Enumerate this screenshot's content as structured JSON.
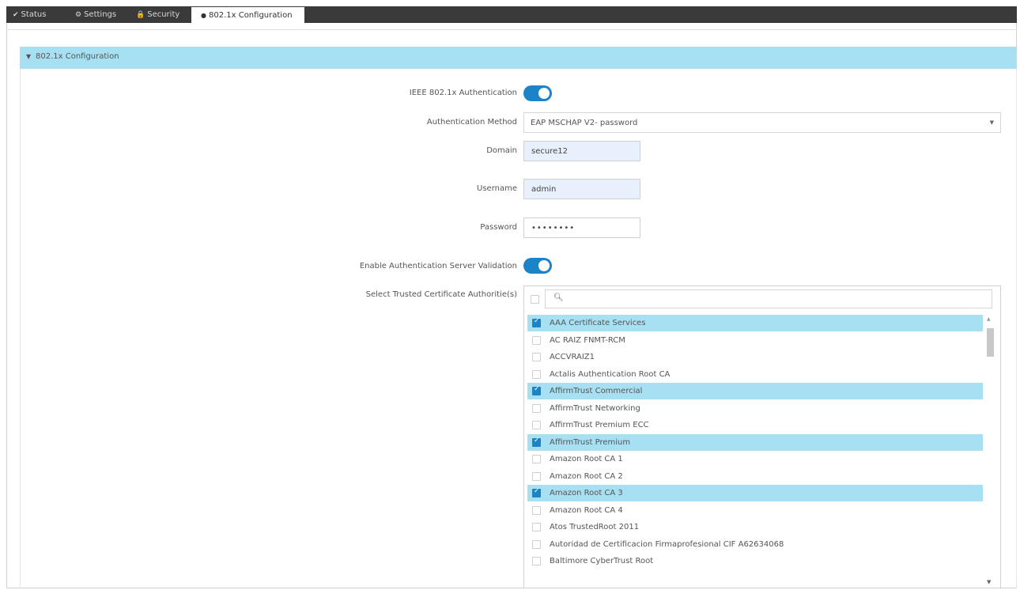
{
  "tabs": [
    {
      "icon": "✔",
      "label": "Status"
    },
    {
      "icon": "⚙",
      "label": "Settings"
    },
    {
      "icon": "🔒",
      "label": "Security"
    },
    {
      "icon": "●",
      "label": "802.1x Configuration"
    }
  ],
  "section": {
    "title": "802.1x Configuration"
  },
  "form": {
    "ieee_auth": {
      "label": "IEEE 802.1x Authentication",
      "enabled": true
    },
    "auth_method": {
      "label": "Authentication Method",
      "value": "EAP MSCHAP V2- password"
    },
    "domain": {
      "label": "Domain",
      "value": "secure12"
    },
    "username": {
      "label": "Username",
      "value": "admin"
    },
    "password": {
      "label": "Password",
      "value": "••••••••"
    },
    "server_validation": {
      "label": "Enable Authentication Server Validation",
      "enabled": true
    },
    "trusted_ca": {
      "label": "Select Trusted Certificate Authoritie(s)"
    }
  },
  "ca_list": [
    {
      "name": "AAA Certificate Services",
      "checked": true
    },
    {
      "name": "AC RAIZ FNMT-RCM",
      "checked": false
    },
    {
      "name": "ACCVRAIZ1",
      "checked": false
    },
    {
      "name": "Actalis Authentication Root CA",
      "checked": false
    },
    {
      "name": "AffirmTrust Commercial",
      "checked": true
    },
    {
      "name": "AffirmTrust Networking",
      "checked": false
    },
    {
      "name": "AffirmTrust Premium ECC",
      "checked": false
    },
    {
      "name": "AffirmTrust Premium",
      "checked": true
    },
    {
      "name": "Amazon Root CA 1",
      "checked": false
    },
    {
      "name": "Amazon Root CA 2",
      "checked": false
    },
    {
      "name": "Amazon Root CA 3",
      "checked": true
    },
    {
      "name": "Amazon Root CA 4",
      "checked": false
    },
    {
      "name": "Atos TrustedRoot 2011",
      "checked": false
    },
    {
      "name": "Autoridad de Certificacion Firmaprofesional CIF A62634068",
      "checked": false
    },
    {
      "name": "Baltimore CyberTrust Root",
      "checked": false
    }
  ]
}
